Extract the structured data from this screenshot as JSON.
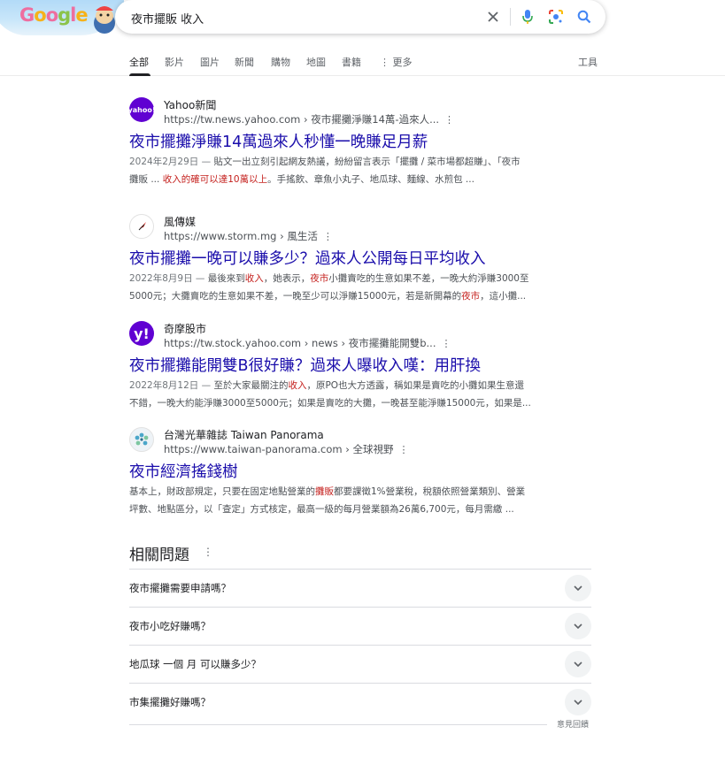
{
  "doodle": {
    "label": "Google",
    "icon": "google-doodle-logo"
  },
  "search": {
    "query": "夜市擺販 收入",
    "icons": [
      "clear-icon",
      "voice-search-icon",
      "lens-icon",
      "search-icon"
    ]
  },
  "tabs": {
    "items": [
      "全部",
      "影片",
      "圖片",
      "新聞",
      "購物",
      "地圖",
      "書籍",
      "更多"
    ],
    "tools": "工具",
    "active": "全部"
  },
  "results": [
    {
      "site_name": "Yahoo新聞",
      "url": "https://tw.news.yahoo.com › 夜市擺攤淨賺14萬-過來人...",
      "title": "夜市擺攤淨賺14萬過來人秒懂一晚賺足月薪",
      "snippet_line1_a": "2024年2月29日 — ",
      "snippet_line1_b": "貼文一出立刻引起網友熱議，紛紛留言表示「擺攤 / 菜市場都超賺」、「夜市",
      "snippet_line2_a": "攤販 ... ",
      "snippet_line2_hl": "收入的確可以達10萬以上",
      "snippet_line2_b": "。手搖飲、章魚小丸子、地瓜球、麵線、水煎包 ...",
      "icon": "yahoo-news-icon"
    },
    {
      "site_name": "風傳媒",
      "url": "https://www.storm.mg › 風生活",
      "title": "夜市擺攤一晚可以賺多少？過來人公開每日平均收入",
      "snippet_line1_a": "2022年8月9日 — ",
      "snippet_line1_b": "最後來到",
      "snippet_line1_hl": "收入",
      "snippet_line1_c": "，她表示，",
      "snippet_line1_hl2": "夜市",
      "snippet_line1_d": "小攤賣吃的生意如果不差，一晚大約淨賺3000至",
      "snippet_line2_a": "5000元；大攤賣吃的生意如果不差，一晚至少可以淨賺15000元，若是新開幕的",
      "snippet_line2_hl": "夜市",
      "snippet_line2_b": "，這小攤...",
      "icon": "storm-media-icon"
    },
    {
      "site_name": "奇摩股市",
      "url": "https://tw.stock.yahoo.com › news › 夜市擺攤能開雙b...",
      "title": "夜市擺攤能開雙B很好賺？過來人曝收入嘆：用肝換",
      "snippet_line1_a": "2022年8月12日 — ",
      "snippet_line1_b": "至於大家最關注的",
      "snippet_line1_hl": "收入",
      "snippet_line1_c": "，原PO也大方透露，稱如果是賣吃的小攤如果生意還",
      "snippet_line2_a": "不錯，一晚大約能淨賺3000至5000元；如果是賣吃的大攤，一晚甚至能淨賺15000元，如果是...",
      "icon": "yahoo-stock-icon"
    },
    {
      "site_name": "台灣光華雜誌 Taiwan Panorama",
      "url": "https://www.taiwan-panorama.com › 全球視野",
      "title": "夜市經濟搖錢樹",
      "snippet_line1_a": "基本上，財政部規定，只要在固定地點營業的",
      "snippet_line1_hl": "攤販",
      "snippet_line1_b": "都要課徵1%營業稅，稅額依照營業類別、營業",
      "snippet_line2_a": "坪數、地點區分，以「查定」方式核定，最高一級的每月營業額為26萬6,700元，每月需繳 ...",
      "icon": "taiwan-panorama-icon"
    }
  ],
  "related": {
    "title": "相關問題",
    "questions": [
      "夜市擺攤需要申請嗎？",
      "夜市小吃好賺嗎？",
      "地瓜球 一個 月 可以賺多少？",
      "市集擺攤好賺嗎？"
    ],
    "feedback": "意見回饋"
  },
  "colors": {
    "link": "#1a0dab",
    "highlight": "#c5221f",
    "text": "#4d5156"
  }
}
